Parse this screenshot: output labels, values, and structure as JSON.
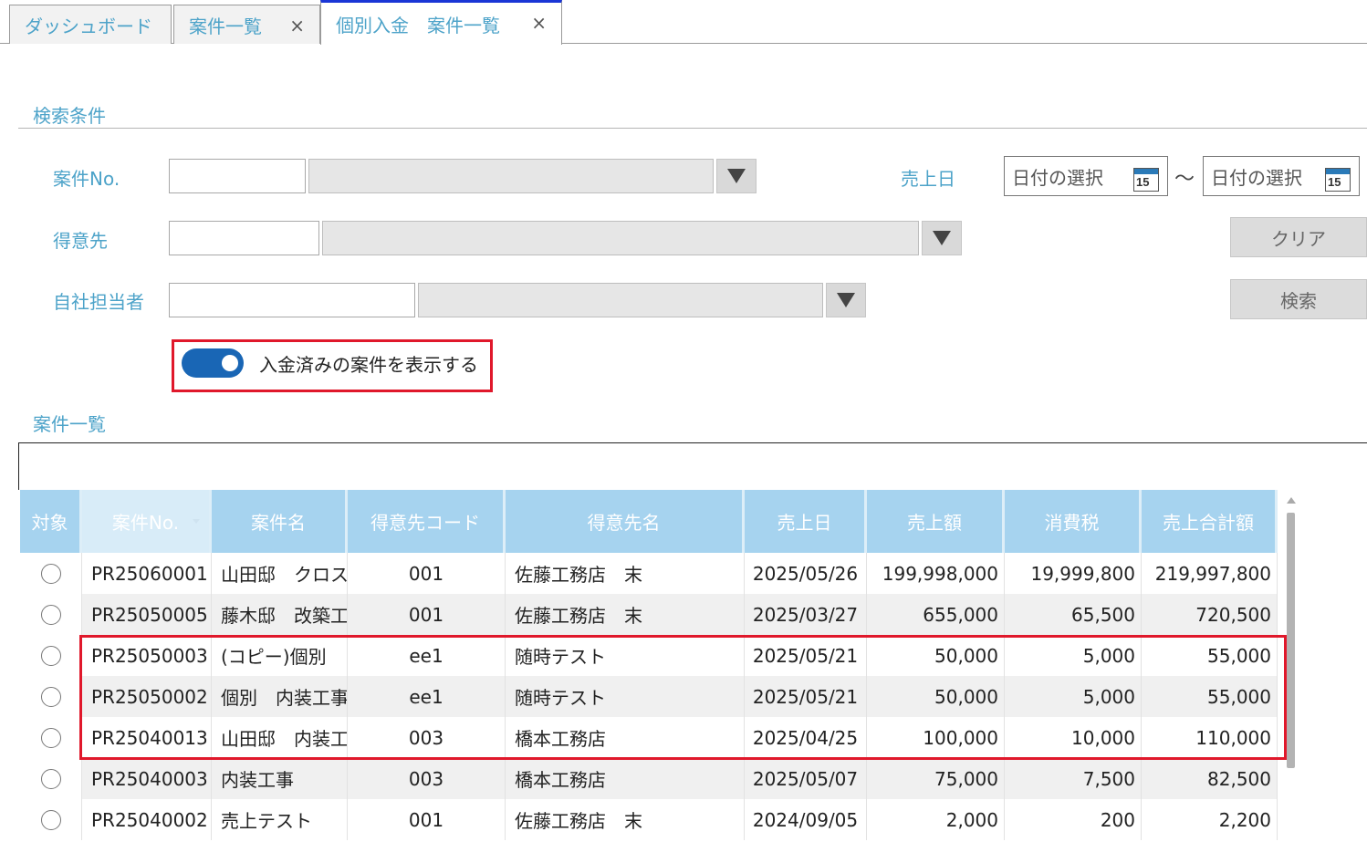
{
  "tabs": [
    {
      "label": "ダッシュボード",
      "closable": false
    },
    {
      "label": "案件一覧",
      "closable": true
    },
    {
      "label": "個別入金　案件一覧",
      "closable": true,
      "active": true
    }
  ],
  "close_glyph": "×",
  "search": {
    "section_title": "検索条件",
    "case_no_label": "案件No.",
    "customer_label": "得意先",
    "staff_label": "自社担当者",
    "sales_date_label": "売上日",
    "date_from_placeholder": "日付の選択",
    "date_to_placeholder": "日付の選択",
    "date_separator": "～",
    "calendar_day": "15",
    "clear_label": "クリア",
    "search_label": "検索",
    "toggle_label": "入金済みの案件を表示する",
    "toggle_on": true
  },
  "list": {
    "section_title": "案件一覧",
    "columns": [
      "対象",
      "案件No.",
      "案件名",
      "得意先コード",
      "得意先名",
      "売上日",
      "売上額",
      "消費税",
      "売上合計額"
    ],
    "rows": [
      {
        "no": "PR25060001",
        "name": "山田邸　クロス",
        "cust_code": "001",
        "cust_name": "佐藤工務店　末",
        "date": "2025/05/26",
        "amount": "199,998,000",
        "tax": "19,999,800",
        "total": "219,997,800"
      },
      {
        "no": "PR25050005",
        "name": "藤木邸　改築工",
        "cust_code": "001",
        "cust_name": "佐藤工務店　末",
        "date": "2025/03/27",
        "amount": "655,000",
        "tax": "65,500",
        "total": "720,500"
      },
      {
        "no": "PR25050003",
        "name": "(コピー)個別",
        "cust_code": "ee1",
        "cust_name": "随時テスト",
        "date": "2025/05/21",
        "amount": "50,000",
        "tax": "5,000",
        "total": "55,000"
      },
      {
        "no": "PR25050002",
        "name": "個別　内装工事",
        "cust_code": "ee1",
        "cust_name": "随時テスト",
        "date": "2025/05/21",
        "amount": "50,000",
        "tax": "5,000",
        "total": "55,000"
      },
      {
        "no": "PR25040013",
        "name": "山田邸　内装工",
        "cust_code": "003",
        "cust_name": "橋本工務店",
        "date": "2025/04/25",
        "amount": "100,000",
        "tax": "10,000",
        "total": "110,000"
      },
      {
        "no": "PR25040003",
        "name": "内装工事",
        "cust_code": "003",
        "cust_name": "橋本工務店",
        "date": "2025/05/07",
        "amount": "75,000",
        "tax": "7,500",
        "total": "82,500"
      },
      {
        "no": "PR25040002",
        "name": "売上テスト",
        "cust_code": "001",
        "cust_name": "佐藤工務店　末",
        "date": "2024/09/05",
        "amount": "2,000",
        "tax": "200",
        "total": "2,200"
      }
    ]
  },
  "colors": {
    "accent_text": "#4da3c9",
    "header_bg": "#a6d3ef",
    "toggle_on": "#1966b5",
    "highlight_box": "#e0182b",
    "active_tab_border": "#1a36d6"
  }
}
